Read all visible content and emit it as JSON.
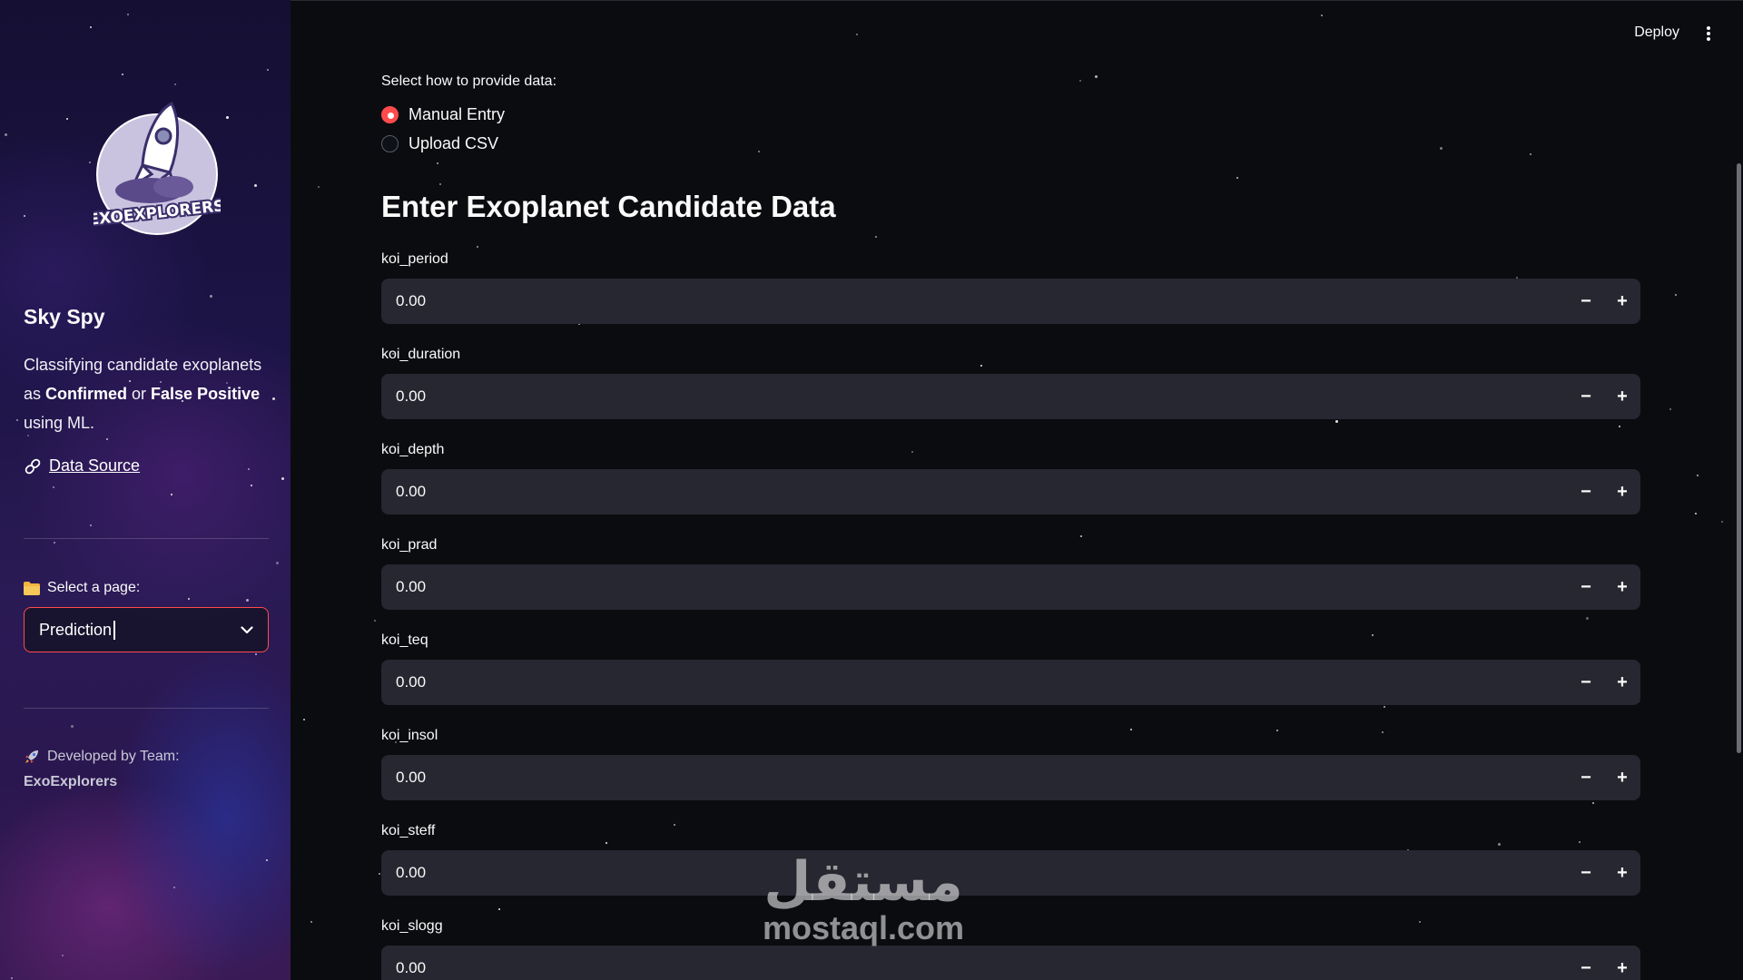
{
  "sidebar": {
    "logo_text": "EXOEXPLORERS",
    "title": "Sky Spy",
    "description": {
      "part1": "Classifying candidate exoplanets as ",
      "bold1": "Confirmed",
      "part2": " or ",
      "bold2": "False Positive",
      "part3": " using ML."
    },
    "data_source_label": "Data Source",
    "select_label": "Select a page:",
    "selected_page": "Prediction",
    "developed_by": "Developed by Team:",
    "team_name": "ExoExplorers"
  },
  "header": {
    "deploy_label": "Deploy"
  },
  "input_mode": {
    "label": "Select how to provide data:",
    "options": [
      "Manual Entry",
      "Upload CSV"
    ],
    "selected": "Manual Entry"
  },
  "form": {
    "heading": "Enter Exoplanet Candidate Data",
    "fields": [
      {
        "label": "koi_period",
        "value": "0.00"
      },
      {
        "label": "koi_duration",
        "value": "0.00"
      },
      {
        "label": "koi_depth",
        "value": "0.00"
      },
      {
        "label": "koi_prad",
        "value": "0.00"
      },
      {
        "label": "koi_teq",
        "value": "0.00"
      },
      {
        "label": "koi_insol",
        "value": "0.00"
      },
      {
        "label": "koi_steff",
        "value": "0.00"
      },
      {
        "label": "koi_slogg",
        "value": "0.00"
      }
    ],
    "minus_label": "−",
    "plus_label": "+"
  },
  "watermark": {
    "arabic": "مستقل",
    "latin": "mostaql.com"
  },
  "colors": {
    "accent": "#ff4b4b",
    "input_bg": "#262730",
    "main_bg": "#0b0c10"
  }
}
